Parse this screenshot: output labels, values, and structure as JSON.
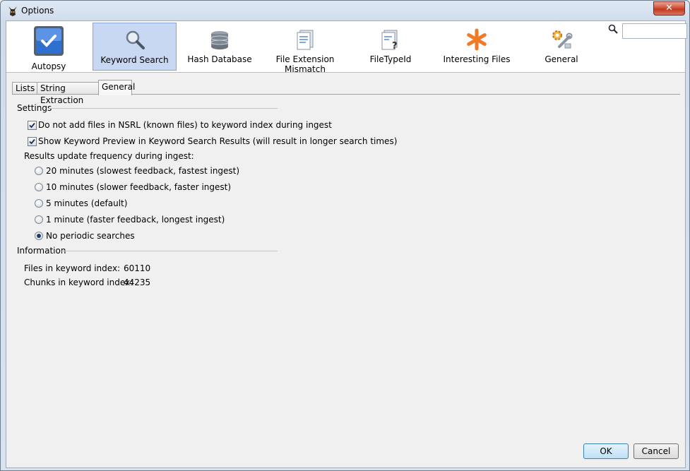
{
  "window": {
    "title": "Options",
    "close_glyph": "✕"
  },
  "toolbar": {
    "items": [
      {
        "label": "Autopsy",
        "icon": "checkmark-icon"
      },
      {
        "label": "Keyword Search",
        "icon": "magnifier-icon",
        "selected": true
      },
      {
        "label": "Hash Database",
        "icon": "database-icon"
      },
      {
        "label": "File Extension Mismatch",
        "icon": "document-icon"
      },
      {
        "label": "FileTypeId",
        "icon": "document-question-icon"
      },
      {
        "label": "Interesting Files",
        "icon": "asterisk-icon"
      },
      {
        "label": "General",
        "icon": "gear-wrench-icon"
      }
    ],
    "search": {
      "value": "",
      "placeholder": ""
    }
  },
  "tabs": [
    {
      "label": "Lists"
    },
    {
      "label": "String Extraction"
    },
    {
      "label": "General",
      "active": true
    }
  ],
  "settings": {
    "title": "Settings",
    "checkboxes": [
      {
        "label": "Do not add files in NSRL (known files) to keyword index during ingest",
        "checked": true
      },
      {
        "label": "Show Keyword Preview in Keyword Search Results (will result in longer search times)",
        "checked": true
      }
    ],
    "frequency_label": "Results update frequency during ingest:",
    "radios": [
      {
        "label": "20 minutes (slowest feedback, fastest ingest)",
        "selected": false
      },
      {
        "label": "10 minutes (slower feedback, faster ingest)",
        "selected": false
      },
      {
        "label": "5 minutes (default)",
        "selected": false
      },
      {
        "label": "1 minute (faster feedback, longest ingest)",
        "selected": false
      },
      {
        "label": "No periodic searches",
        "selected": true
      }
    ]
  },
  "information": {
    "title": "Information",
    "files_label": "Files in keyword index:",
    "files_value": "60110",
    "chunks_label": "Chunks in keyword index:",
    "chunks_value": "44235"
  },
  "buttons": {
    "ok": "OK",
    "cancel": "Cancel"
  },
  "colors": {
    "selected_bg": "#c9d8f2",
    "asterisk": "#f07a25",
    "close_red": "#c0391f"
  }
}
